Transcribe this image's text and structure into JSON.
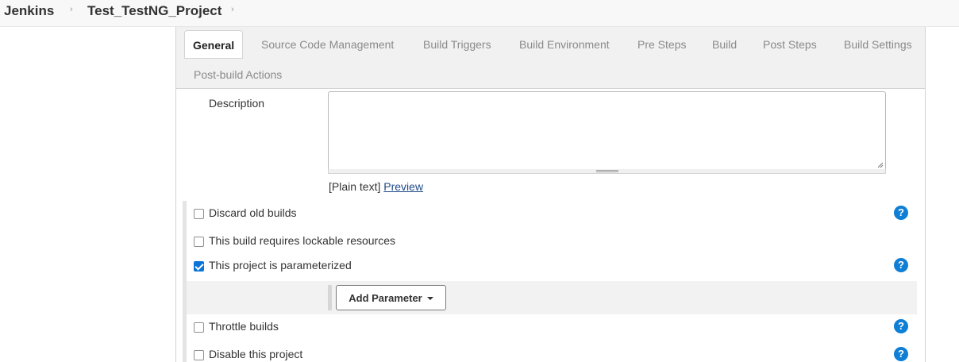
{
  "breadcrumb": {
    "items": [
      "Jenkins",
      "Test_TestNG_Project"
    ],
    "separator": "›"
  },
  "tabs": [
    {
      "label": "General",
      "active": true
    },
    {
      "label": "Source Code Management"
    },
    {
      "label": "Build Triggers"
    },
    {
      "label": "Build Environment"
    },
    {
      "label": "Pre Steps"
    },
    {
      "label": "Build"
    },
    {
      "label": "Post Steps"
    },
    {
      "label": "Build Settings"
    },
    {
      "label": "Post-build Actions"
    }
  ],
  "description": {
    "label": "Description",
    "value": "",
    "format_note": "[Plain text]",
    "preview_link": "Preview"
  },
  "options": [
    {
      "label": "Discard old builds",
      "checked": false,
      "help": true
    },
    {
      "label": "This build requires lockable resources",
      "checked": false,
      "help": false
    },
    {
      "label": "This project is parameterized",
      "checked": true,
      "help": true
    },
    {
      "label": "Throttle builds",
      "checked": false,
      "help": true
    },
    {
      "label": "Disable this project",
      "checked": false,
      "help": true
    }
  ],
  "add_parameter_label": "Add Parameter",
  "help_icon_glyph": "?",
  "colors": {
    "accent": "#0f7fd6",
    "link": "#204a87",
    "tab_bar": "#f1f1f1"
  }
}
